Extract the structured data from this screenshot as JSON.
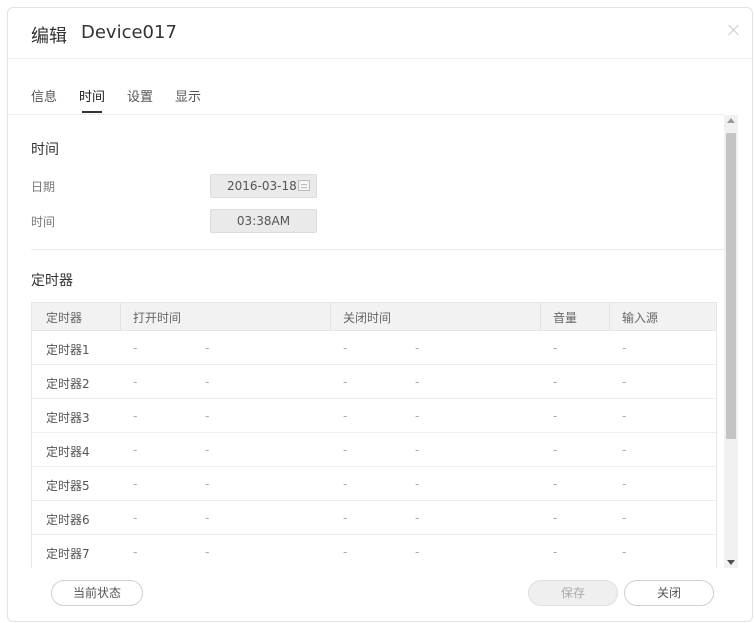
{
  "dialog": {
    "title_label": "编辑",
    "device_name": "Device017"
  },
  "tabs": [
    {
      "label": "信息"
    },
    {
      "label": "时间"
    },
    {
      "label": "设置"
    },
    {
      "label": "显示"
    }
  ],
  "active_tab": "时间",
  "time_section": {
    "title": "时间",
    "date_label": "日期",
    "date_value": "2016-03-18",
    "time_label": "时间",
    "time_value": "03:38AM"
  },
  "timer_section": {
    "title": "定时器",
    "columns": [
      "定时器",
      "打开时间",
      "关闭时间",
      "音量",
      "输入源"
    ],
    "rows": [
      {
        "name": "定时器1",
        "on1": "-",
        "on2": "-",
        "off1": "-",
        "off2": "-",
        "volume": "-",
        "source": "-"
      },
      {
        "name": "定时器2",
        "on1": "-",
        "on2": "-",
        "off1": "-",
        "off2": "-",
        "volume": "-",
        "source": "-"
      },
      {
        "name": "定时器3",
        "on1": "-",
        "on2": "-",
        "off1": "-",
        "off2": "-",
        "volume": "-",
        "source": "-"
      },
      {
        "name": "定时器4",
        "on1": "-",
        "on2": "-",
        "off1": "-",
        "off2": "-",
        "volume": "-",
        "source": "-"
      },
      {
        "name": "定时器5",
        "on1": "-",
        "on2": "-",
        "off1": "-",
        "off2": "-",
        "volume": "-",
        "source": "-"
      },
      {
        "name": "定时器6",
        "on1": "-",
        "on2": "-",
        "off1": "-",
        "off2": "-",
        "volume": "-",
        "source": "-"
      },
      {
        "name": "定时器7",
        "on1": "-",
        "on2": "-",
        "off1": "-",
        "off2": "-",
        "volume": "-",
        "source": "-"
      }
    ]
  },
  "footer": {
    "status_button": "当前状态",
    "save_button": "保存",
    "close_button": "关闭"
  }
}
